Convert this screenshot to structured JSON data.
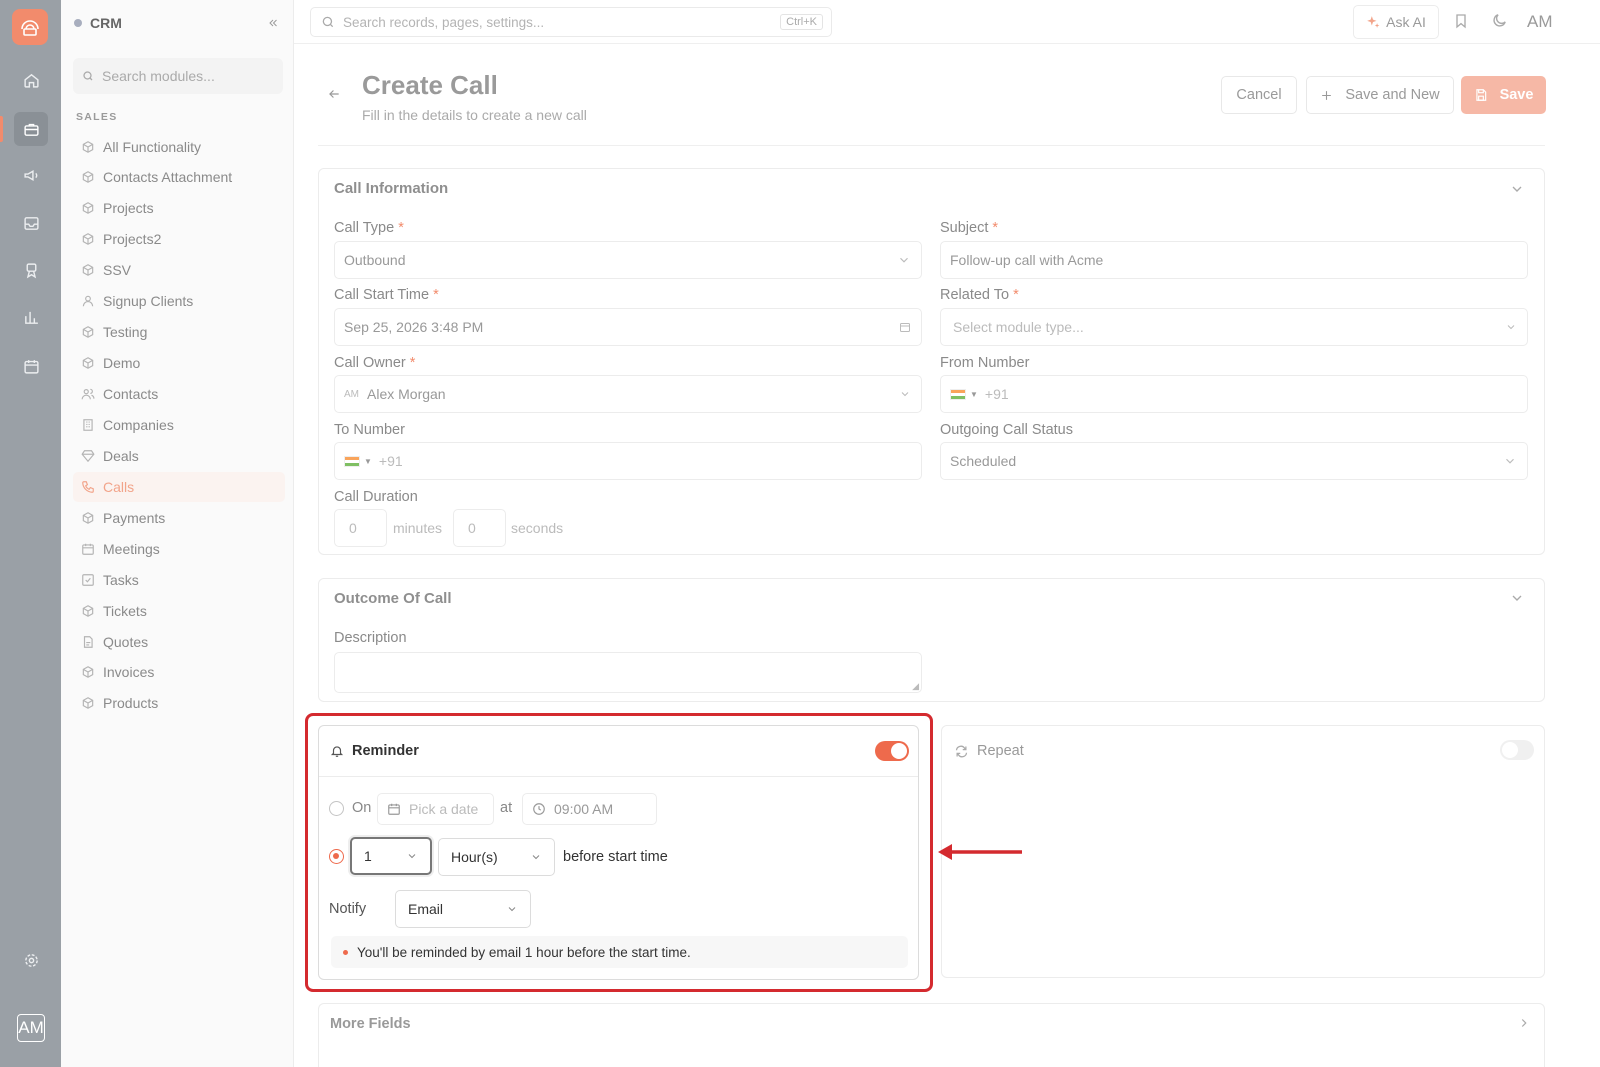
{
  "app": {
    "name": "CRM",
    "avatar_initials": "AM"
  },
  "rail": {
    "icons": [
      "home-icon",
      "briefcase-icon",
      "megaphone-icon",
      "inbox-icon",
      "award-icon",
      "bar-chart-icon",
      "calendar-icon",
      "settings-icon"
    ],
    "active": "briefcase-icon",
    "accent_color": "#f28b6c"
  },
  "sidebar": {
    "search_placeholder": "Search modules...",
    "section_label": "SALES",
    "items": [
      {
        "label": "All Functionality"
      },
      {
        "label": "Contacts Attachment"
      },
      {
        "label": "Projects"
      },
      {
        "label": "Projects2"
      },
      {
        "label": "SSV"
      },
      {
        "label": "Signup Clients"
      },
      {
        "label": "Testing"
      },
      {
        "label": "Demo"
      },
      {
        "label": "Contacts"
      },
      {
        "label": "Companies"
      },
      {
        "label": "Deals"
      },
      {
        "label": "Calls",
        "active": true
      },
      {
        "label": "Payments"
      },
      {
        "label": "Meetings"
      },
      {
        "label": "Tasks"
      },
      {
        "label": "Tickets"
      },
      {
        "label": "Quotes"
      },
      {
        "label": "Invoices"
      },
      {
        "label": "Products"
      }
    ]
  },
  "topbar": {
    "search_placeholder": "Search records, pages, settings...",
    "shortcut": "Ctrl+K",
    "ask_ai_label": "Ask AI",
    "user_initials": "AM"
  },
  "header": {
    "title": "Create Call",
    "subtitle": "Fill in the details to create a new call",
    "cancel_label": "Cancel",
    "save_new_label": "Save and New",
    "save_label": "Save"
  },
  "call_info": {
    "title": "Call Information",
    "call_type": {
      "label": "Call Type",
      "value": "Outbound"
    },
    "subject": {
      "label": "Subject",
      "value": "Follow-up call with Acme"
    },
    "call_start_time": {
      "label": "Call Start Time",
      "value": "Sep 25, 2026 3:48 PM"
    },
    "related_to": {
      "label": "Related To",
      "placeholder": "Select module type..."
    },
    "call_owner": {
      "label": "Call Owner",
      "initials": "AM",
      "value": "Alex Morgan"
    },
    "from_number": {
      "label": "From Number",
      "prefix": "+91"
    },
    "to_number": {
      "label": "To Number",
      "prefix": "+91"
    },
    "outgoing_status": {
      "label": "Outgoing Call Status",
      "value": "Scheduled"
    },
    "duration": {
      "label": "Call Duration",
      "minutes": "0",
      "minutes_label": "minutes",
      "seconds": "0",
      "seconds_label": "seconds"
    }
  },
  "outcome": {
    "title": "Outcome Of Call",
    "description_label": "Description"
  },
  "reminder": {
    "title": "Reminder",
    "enabled": true,
    "on_label": "On",
    "date_placeholder": "Pick a date",
    "at_label": "at",
    "time_value": "09:00 AM",
    "before_selected": true,
    "amount": "1",
    "unit": "Hour(s)",
    "before_label": "before start time",
    "notify_label": "Notify",
    "notify_value": "Email",
    "note": "You'll be reminded by email 1 hour before the start time."
  },
  "repeat": {
    "title": "Repeat",
    "enabled": false
  },
  "more_fields": {
    "title": "More Fields"
  },
  "annotation": {
    "color": "#d42a2f"
  }
}
